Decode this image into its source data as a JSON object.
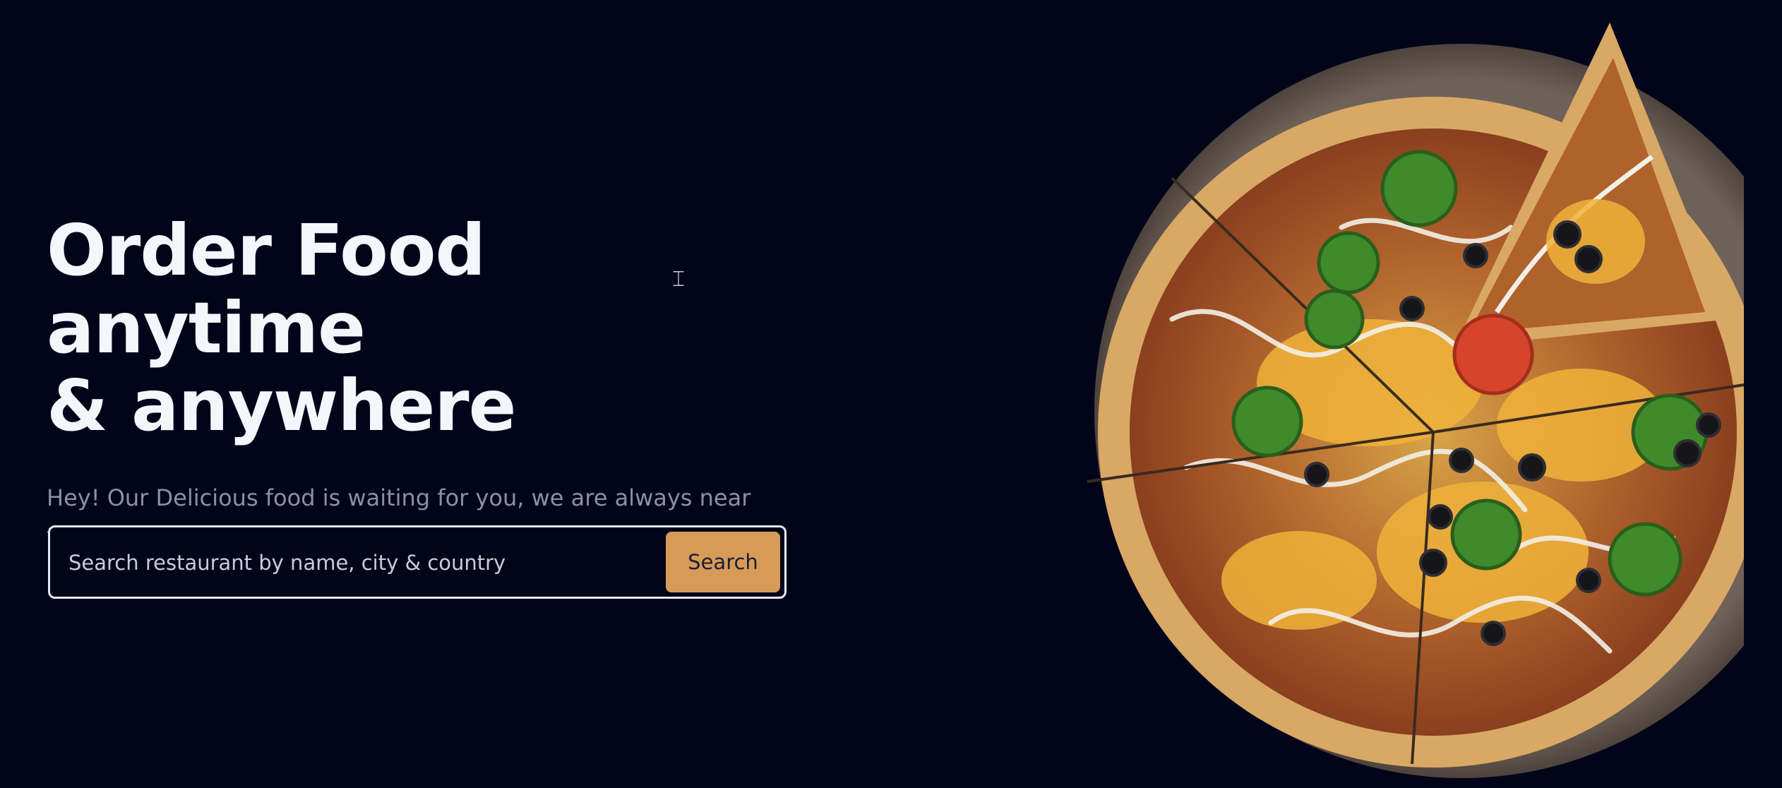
{
  "hero": {
    "title_line1": "Order Food anytime",
    "title_line2": "& anywhere",
    "subtitle": "Hey! Our Delicious food is waiting for you, we are always near to you."
  },
  "search": {
    "placeholder": "Search restaurant by name, city & country",
    "button_label": "Search"
  },
  "colors": {
    "background": "#02051a",
    "accent": "#d79a57",
    "headline": "#f4f6fb",
    "subtitle": "#8b8fa8"
  },
  "icons": {
    "text_cursor": "I-beam-cursor"
  }
}
